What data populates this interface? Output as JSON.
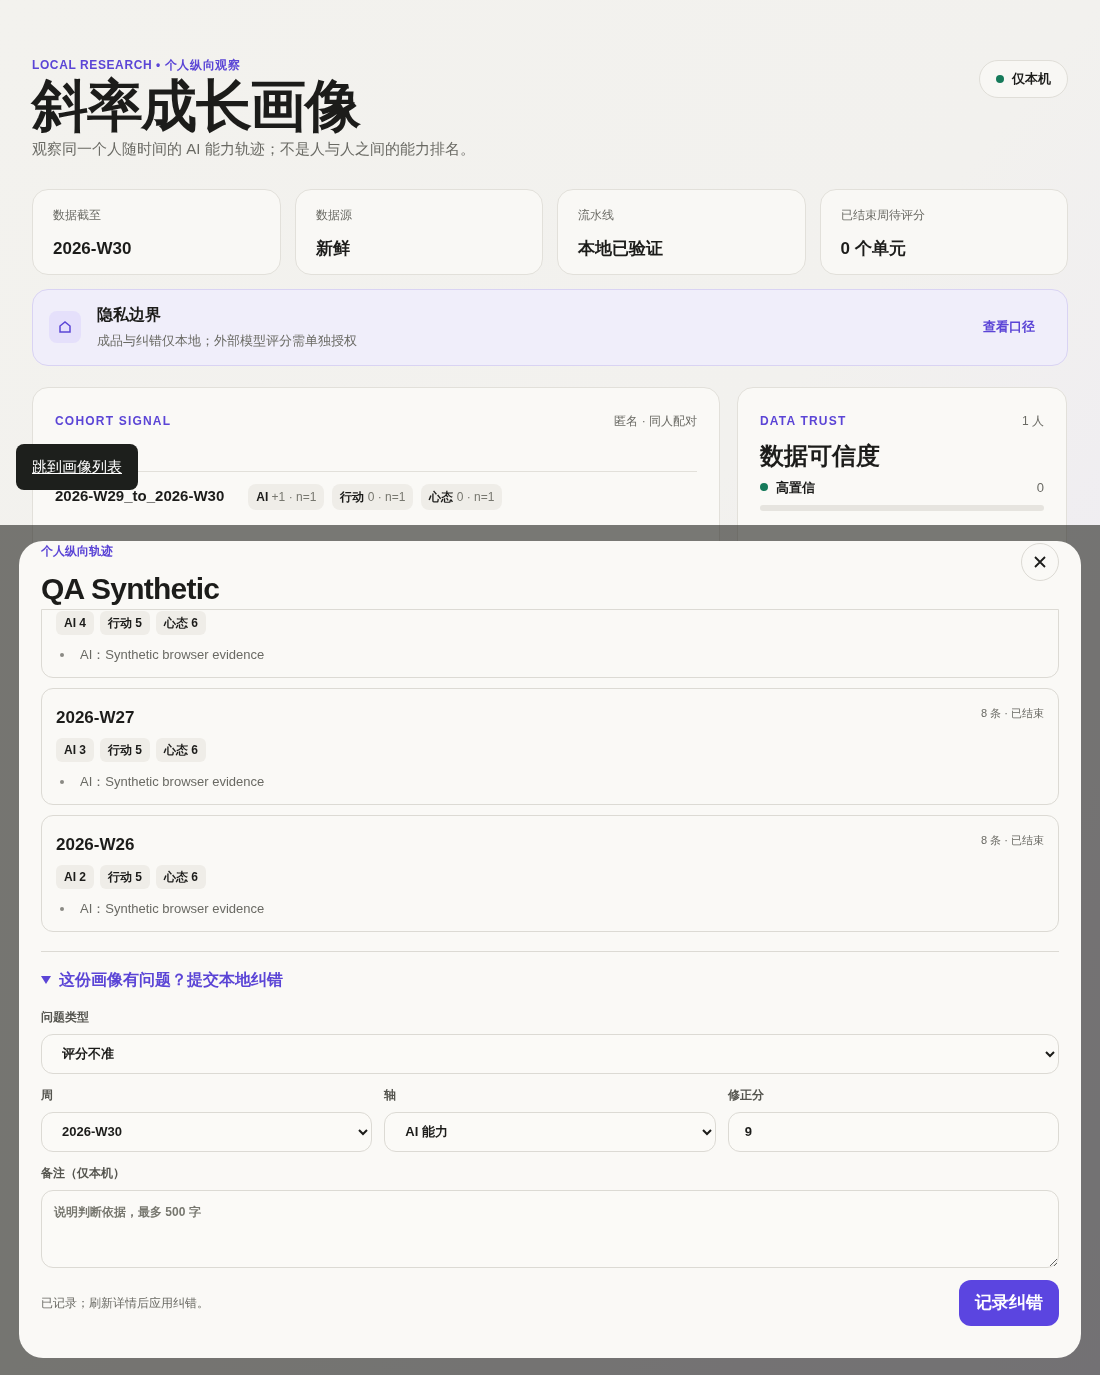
{
  "header": {
    "eyebrow": "LOCAL RESEARCH • 个人纵向观察",
    "title": "斜率成长画像",
    "subtitle": "观察同一个人随时间的 AI 能力轨迹；不是人与人之间的能力排名。",
    "badge": {
      "label": "仅本机",
      "color": "#157a5a"
    }
  },
  "stats": [
    {
      "label": "数据截至",
      "value": "2026-W30"
    },
    {
      "label": "数据源",
      "value": "新鲜"
    },
    {
      "label": "流水线",
      "value": "本地已验证"
    },
    {
      "label": "已结束周待评分",
      "value": "0 个单元"
    }
  ],
  "privacy": {
    "title": "隐私边界",
    "text": "成品与纠错仅本地；外部模型评分需单独授权",
    "link": "查看口径"
  },
  "cohort": {
    "eyebrow": "COHORT SIGNAL",
    "meta": "匿名 · 同人配对",
    "tooltip": "跳到画像列表",
    "range": "2026-W29_to_2026-W30",
    "chips": [
      {
        "label": "AI",
        "detail": "+1 · n=1"
      },
      {
        "label": "行动",
        "detail": "0 · n=1"
      },
      {
        "label": "心态",
        "detail": "0 · n=1"
      }
    ]
  },
  "trust": {
    "eyebrow": "DATA TRUST",
    "count": "1 人",
    "title": "数据可信度",
    "rows": [
      {
        "label": "高置信",
        "value": "0",
        "color": "#157a5a",
        "level": 0
      }
    ]
  },
  "modal": {
    "eyebrow": "个人纵向轨迹",
    "title": "QA Synthetic",
    "weeks": [
      {
        "chips": [
          "AI 4",
          "行动 5",
          "心态 6"
        ],
        "evidence": [
          "AI：Synthetic browser evidence"
        ]
      },
      {
        "week": "2026-W27",
        "meta": "8 条 · 已结束",
        "chips": [
          "AI 3",
          "行动 5",
          "心态 6"
        ],
        "evidence": [
          "AI：Synthetic browser evidence"
        ]
      },
      {
        "week": "2026-W26",
        "meta": "8 条 · 已结束",
        "chips": [
          "AI 2",
          "行动 5",
          "心态 6"
        ],
        "evidence": [
          "AI：Synthetic browser evidence"
        ]
      }
    ],
    "correction": {
      "summary": "这份画像有问题？提交本地纠错",
      "expanded": true,
      "fields": [
        {
          "kind": "select",
          "label": "问题类型",
          "value": "评分不准"
        },
        {
          "kind": "select",
          "label": "周",
          "value": "2026-W30"
        },
        {
          "kind": "select",
          "label": "轴",
          "value": "AI 能力"
        },
        {
          "kind": "input",
          "label": "修正分",
          "value": "9"
        }
      ],
      "note": {
        "label": "备注（仅本机）",
        "placeholder": "说明判断依据，最多 500 字"
      },
      "status": "已记录；刷新详情后应用纠错。",
      "submit": "记录纠错"
    }
  }
}
